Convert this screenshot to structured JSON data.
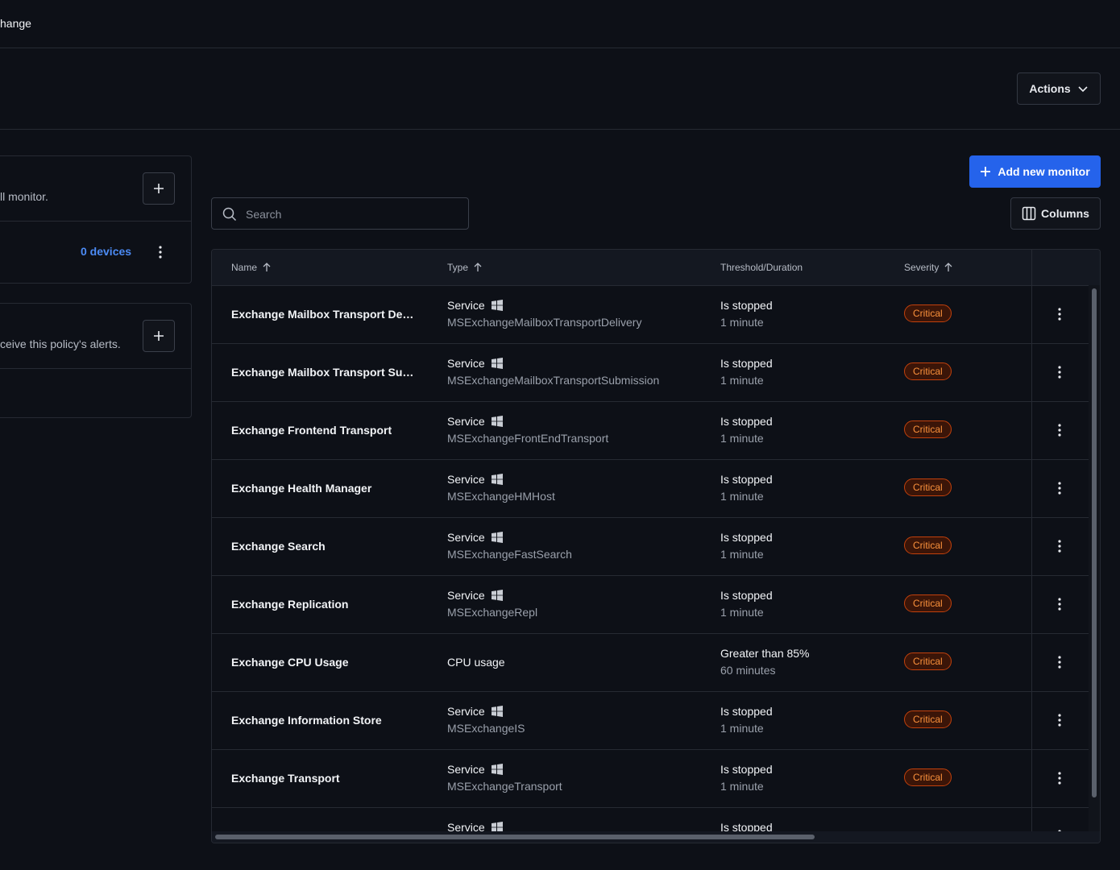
{
  "topbar": {
    "title": "hange"
  },
  "header": {
    "actions_label": "Actions"
  },
  "left": {
    "card1": {
      "text": "ll monitor.",
      "devices_link": "0 devices"
    },
    "card2": {
      "text": "ceive this policy's alerts."
    }
  },
  "toolbar": {
    "add_label": "Add new monitor",
    "columns_label": "Columns",
    "search_placeholder": "Search"
  },
  "table": {
    "columns": {
      "name": "Name",
      "type": "Type",
      "threshold": "Threshold/Duration",
      "severity": "Severity"
    },
    "rows": [
      {
        "name": "Exchange Mailbox Transport De…",
        "type": "Service",
        "sub": "MSExchangeMailboxTransportDelivery",
        "threshold": "Is stopped",
        "duration": "1 minute",
        "severity": "Critical"
      },
      {
        "name": "Exchange Mailbox Transport Su…",
        "type": "Service",
        "sub": "MSExchangeMailboxTransportSubmission",
        "threshold": "Is stopped",
        "duration": "1 minute",
        "severity": "Critical"
      },
      {
        "name": "Exchange Frontend Transport",
        "type": "Service",
        "sub": "MSExchangeFrontEndTransport",
        "threshold": "Is stopped",
        "duration": "1 minute",
        "severity": "Critical"
      },
      {
        "name": "Exchange Health Manager",
        "type": "Service",
        "sub": "MSExchangeHMHost",
        "threshold": "Is stopped",
        "duration": "1 minute",
        "severity": "Critical"
      },
      {
        "name": "Exchange Search",
        "type": "Service",
        "sub": "MSExchangeFastSearch",
        "threshold": "Is stopped",
        "duration": "1 minute",
        "severity": "Critical"
      },
      {
        "name": "Exchange Replication",
        "type": "Service",
        "sub": "MSExchangeRepl",
        "threshold": "Is stopped",
        "duration": "1 minute",
        "severity": "Critical"
      },
      {
        "name": "Exchange CPU Usage",
        "type": "CPU usage",
        "sub": "",
        "threshold": "Greater than 85%",
        "duration": "60 minutes",
        "severity": "Critical"
      },
      {
        "name": "Exchange Information Store",
        "type": "Service",
        "sub": "MSExchangeIS",
        "threshold": "Is stopped",
        "duration": "1 minute",
        "severity": "Critical"
      },
      {
        "name": "Exchange Transport",
        "type": "Service",
        "sub": "MSExchangeTransport",
        "threshold": "Is stopped",
        "duration": "1 minute",
        "severity": "Critical"
      },
      {
        "name": "",
        "type": "Service",
        "sub": "",
        "threshold": "Is stopped",
        "duration": "",
        "severity": ""
      }
    ]
  }
}
